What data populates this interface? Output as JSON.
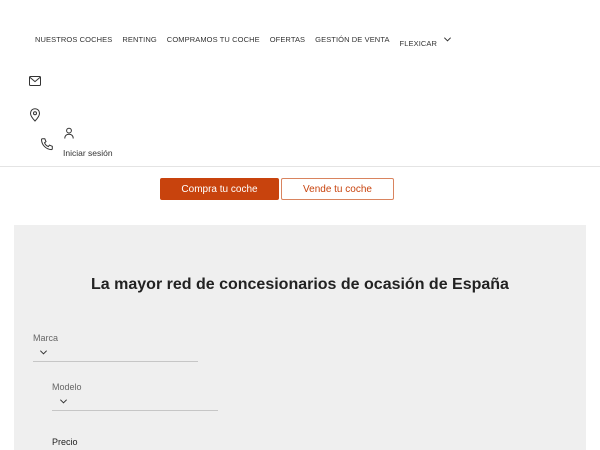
{
  "nav": {
    "items": [
      {
        "label": "NUESTROS COCHES"
      },
      {
        "label": "RENTING"
      },
      {
        "label": "COMPRAMOS TU COCHE"
      },
      {
        "label": "OFERTAS"
      },
      {
        "label": "GESTIÓN DE VENTA"
      },
      {
        "label": "FLEXICAR"
      }
    ],
    "dropdown_icon": "chevron-down-icon"
  },
  "header_icons": [
    "mail-icon",
    "location-pin-icon",
    "phone-icon",
    "user-icon"
  ],
  "login": {
    "label": "Iniciar sesión"
  },
  "tabs": [
    {
      "label": "Compra tu coche",
      "active": true
    },
    {
      "label": "Vende tu coche",
      "active": false
    }
  ],
  "search": {
    "title": "La mayor red de concesionarios de ocasión de España",
    "brand_label": "Marca",
    "model_label": "Modelo",
    "price_label": "Precio"
  },
  "colors": {
    "accent": "#c8430d",
    "panel_background": "#efefef"
  }
}
